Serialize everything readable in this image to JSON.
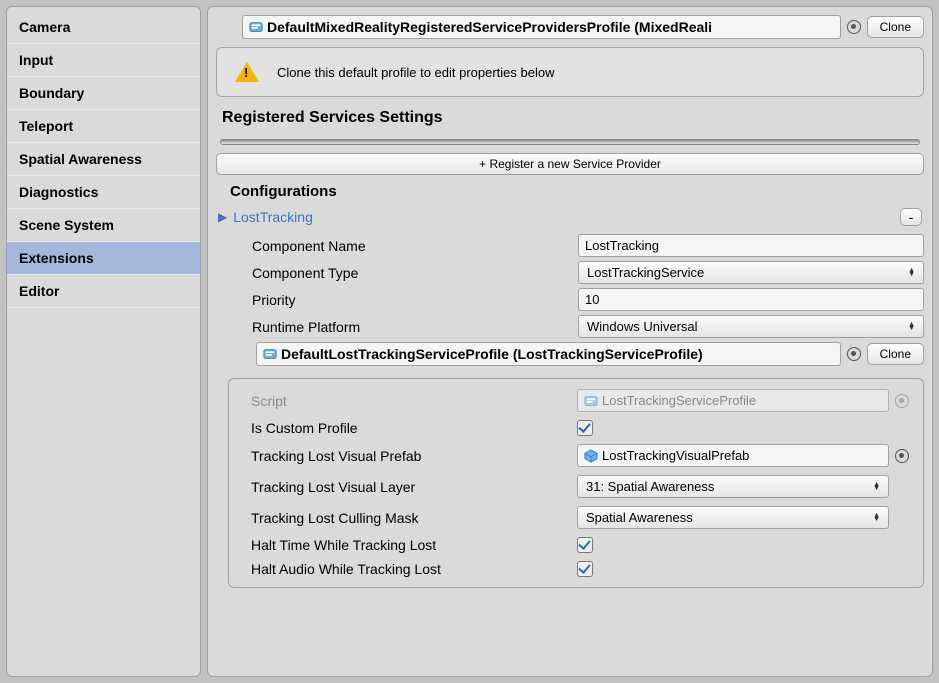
{
  "sidebar": {
    "items": [
      {
        "label": "Camera"
      },
      {
        "label": "Input"
      },
      {
        "label": "Boundary"
      },
      {
        "label": "Teleport"
      },
      {
        "label": "Spatial Awareness"
      },
      {
        "label": "Diagnostics"
      },
      {
        "label": "Scene System"
      },
      {
        "label": "Extensions"
      },
      {
        "label": "Editor"
      }
    ],
    "selected_index": 7
  },
  "main": {
    "profile_name": "DefaultMixedRealityRegisteredServiceProvidersProfile (MixedReali",
    "clone_label": "Clone",
    "warning_text": "Clone this default profile to edit properties below",
    "section_title": "Registered Services Settings",
    "register_btn": "+ Register a new Service Provider",
    "configs_heading": "Configurations",
    "foldout_title": "LostTracking",
    "minus_label": "-",
    "component": {
      "name_label": "Component Name",
      "name_value": "LostTracking",
      "type_label": "Component Type",
      "type_value": "LostTrackingService",
      "priority_label": "Priority",
      "priority_value": "10",
      "runtime_label": "Runtime Platform",
      "runtime_value": "Windows Universal"
    },
    "sub_profile": {
      "name": "DefaultLostTrackingServiceProfile (LostTrackingServiceProfile)",
      "clone_label": "Clone",
      "props": {
        "script_label": "Script",
        "script_value": "LostTrackingServiceProfile",
        "is_custom_label": "Is Custom Profile",
        "is_custom_checked": true,
        "prefab_label": "Tracking Lost Visual Prefab",
        "prefab_value": "LostTrackingVisualPrefab",
        "layer_label": "Tracking Lost Visual Layer",
        "layer_value": "31: Spatial Awareness",
        "mask_label": "Tracking Lost Culling Mask",
        "mask_value": "Spatial Awareness",
        "halt_time_label": "Halt Time While Tracking Lost",
        "halt_time_checked": true,
        "halt_audio_label": "Halt Audio While Tracking Lost",
        "halt_audio_checked": true
      }
    }
  }
}
